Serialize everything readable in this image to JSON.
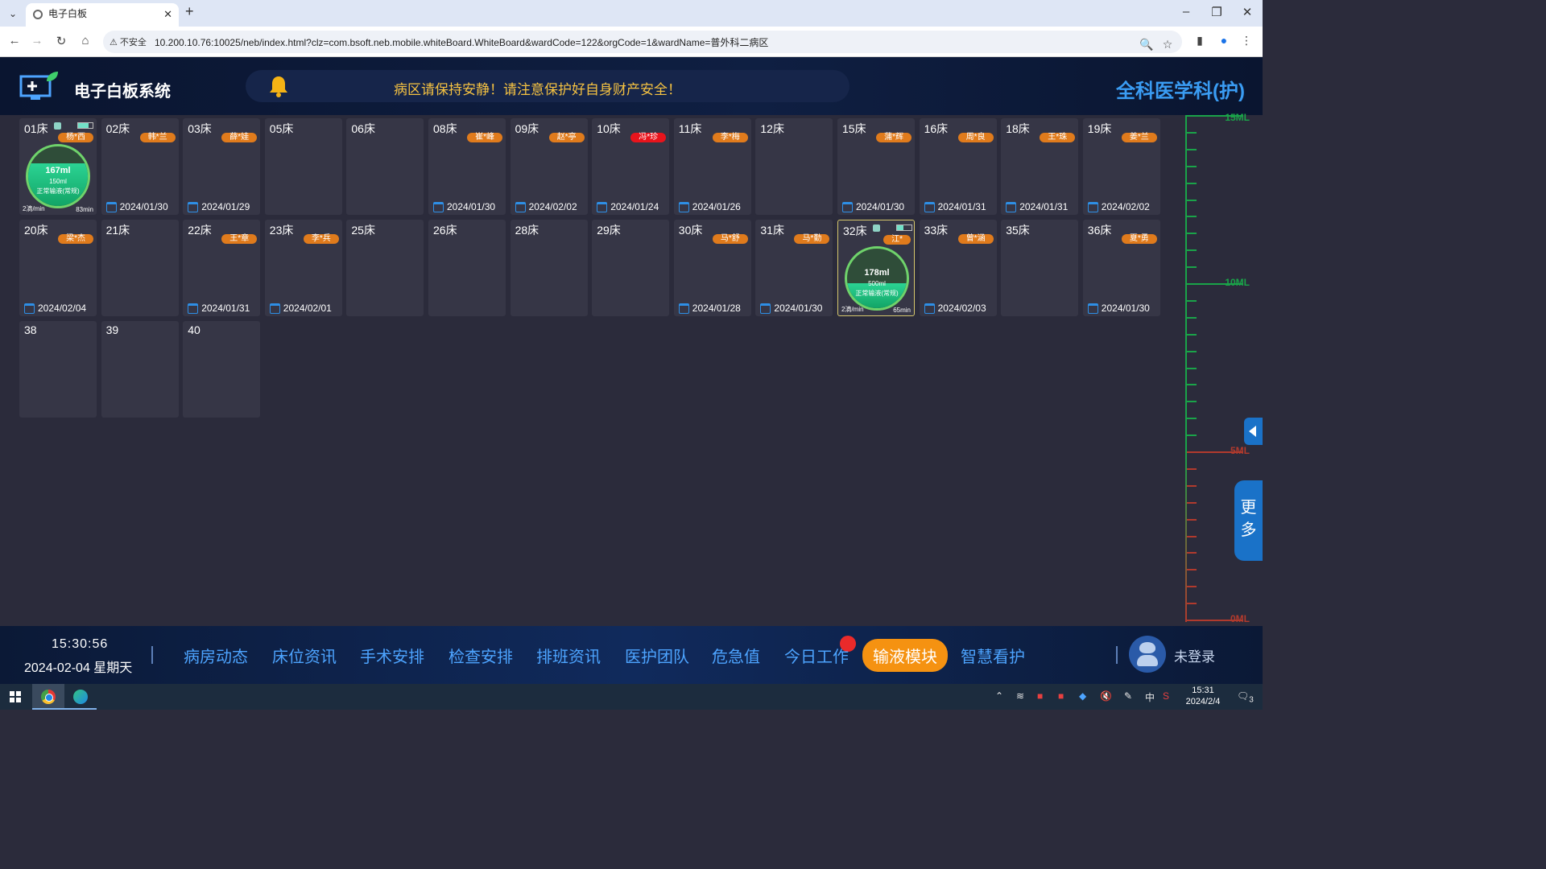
{
  "browser": {
    "tab_title": "电子白板",
    "security_label": "不安全",
    "url": "10.200.10.76:10025/neb/index.html?clz=com.bsoft.neb.mobile.whiteBoard.WhiteBoard&wardCode=122&orgCode=1&wardName=普外科二病区"
  },
  "header": {
    "title": "电子白板系统",
    "notice": "病区请保持安静！请注意保护好自身财产安全！",
    "department": "全科医学科(护)"
  },
  "beds": [
    {
      "no": "01床",
      "name": "杨*西",
      "date": "",
      "infusion": {
        "volume": "167ml",
        "total": "150ml",
        "status": "正常输液(常规)",
        "rate": "2滴/min",
        "remaining": "83min",
        "level": 0.72
      }
    },
    {
      "no": "02床",
      "name": "韩*兰",
      "date": "2024/01/30"
    },
    {
      "no": "03床",
      "name": "薛*娃",
      "date": "2024/01/29"
    },
    {
      "no": "05床",
      "name": "",
      "date": ""
    },
    {
      "no": "06床",
      "name": "",
      "date": ""
    },
    {
      "no": "08床",
      "name": "崔*峰",
      "date": "2024/01/30"
    },
    {
      "no": "09床",
      "name": "赵*亭",
      "date": "2024/02/02"
    },
    {
      "no": "10床",
      "name": "冯*珍",
      "date": "2024/01/24",
      "alert": true
    },
    {
      "no": "11床",
      "name": "李*梅",
      "date": "2024/01/26"
    },
    {
      "no": "12床",
      "name": "",
      "date": ""
    },
    {
      "no": "15床",
      "name": "蒲*辉",
      "date": "2024/01/30"
    },
    {
      "no": "16床",
      "name": "周*良",
      "date": "2024/01/31"
    },
    {
      "no": "18床",
      "name": "王*珠",
      "date": "2024/01/31"
    },
    {
      "no": "19床",
      "name": "姜*兰",
      "date": "2024/02/02"
    },
    {
      "no": "20床",
      "name": "梁*杰",
      "date": "2024/02/04"
    },
    {
      "no": "21床",
      "name": "",
      "date": ""
    },
    {
      "no": "22床",
      "name": "王*章",
      "date": "2024/01/31"
    },
    {
      "no": "23床",
      "name": "李*兵",
      "date": "2024/02/01"
    },
    {
      "no": "25床",
      "name": "",
      "date": ""
    },
    {
      "no": "26床",
      "name": "",
      "date": ""
    },
    {
      "no": "28床",
      "name": "",
      "date": ""
    },
    {
      "no": "29床",
      "name": "",
      "date": ""
    },
    {
      "no": "30床",
      "name": "马*舒",
      "date": "2024/01/28"
    },
    {
      "no": "31床",
      "name": "马*勤",
      "date": "2024/01/30"
    },
    {
      "no": "32床",
      "name": "江*",
      "date": "",
      "infusion": {
        "volume": "178ml",
        "total": "500ml",
        "status": "正常输液(常规)",
        "rate": "2滴/min",
        "remaining": "65min",
        "level": 0.42
      },
      "selected": true
    },
    {
      "no": "33床",
      "name": "曾*涵",
      "date": "2024/02/03"
    },
    {
      "no": "35床",
      "name": "",
      "date": ""
    },
    {
      "no": "36床",
      "name": "夏*勇",
      "date": "2024/01/30"
    },
    {
      "no": "38",
      "name": "",
      "date": ""
    },
    {
      "no": "39",
      "name": "",
      "date": ""
    },
    {
      "no": "40",
      "name": "",
      "date": ""
    }
  ],
  "scale": {
    "labels": [
      "15ML",
      "10ML",
      "5ML",
      "0ML"
    ],
    "green": "#1aa349",
    "red": "#b13a2d"
  },
  "side": {
    "more_label": "更多"
  },
  "footer": {
    "time": "15:30:56",
    "date": "2024-02-04 星期天",
    "nav": [
      "病房动态",
      "床位资讯",
      "手术安排",
      "检查安排",
      "排班资讯",
      "医护团队",
      "危急值",
      "今日工作",
      "输液模块",
      "智慧看护"
    ],
    "active_nav": "输液模块",
    "login": "未登录"
  },
  "taskbar": {
    "time": "15:31",
    "date": "2024/2/4",
    "ime": "中",
    "notification_count": "3"
  }
}
